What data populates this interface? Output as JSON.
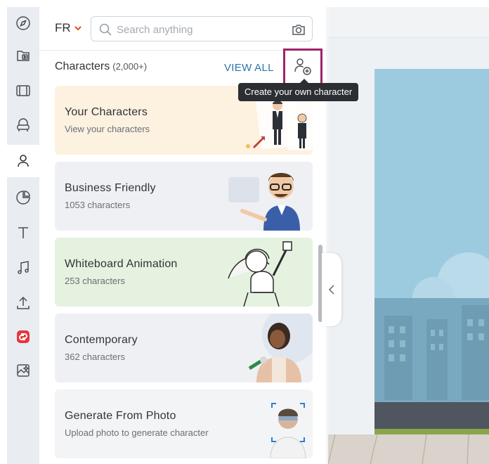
{
  "rail": {
    "items": [
      {
        "icon": "compass-icon"
      },
      {
        "icon": "media-library-icon"
      },
      {
        "icon": "scenes-icon"
      },
      {
        "icon": "props-icon"
      },
      {
        "icon": "characters-icon",
        "active": true
      },
      {
        "icon": "charts-icon"
      },
      {
        "icon": "text-icon"
      },
      {
        "icon": "music-icon"
      },
      {
        "icon": "upload-icon"
      },
      {
        "icon": "brand-app-icon",
        "color": "#e8343b"
      },
      {
        "icon": "ai-image-icon"
      }
    ]
  },
  "topbar": {
    "language": "FR",
    "search_placeholder": "Search anything"
  },
  "section": {
    "title": "Characters",
    "count": "(2,000+)",
    "view_all": "VIEW ALL"
  },
  "tooltip": {
    "text": "Create your own character"
  },
  "cards": [
    {
      "title": "Your Characters",
      "subtitle": "View your characters",
      "bg": "#fdf1e0"
    },
    {
      "title": "Business Friendly",
      "subtitle": "1053 characters",
      "bg": "#eef0f4"
    },
    {
      "title": "Whiteboard Animation",
      "subtitle": "253 characters",
      "bg": "#e4f2df"
    },
    {
      "title": "Contemporary",
      "subtitle": "362 characters",
      "bg": "#eef0f4"
    },
    {
      "title": "Generate From Photo",
      "subtitle": "Upload photo to generate character",
      "bg": "#f3f4f6"
    }
  ],
  "colors": {
    "accent": "#2a78a8",
    "highlight_border": "#a0236b",
    "tooltip_bg": "#2b2e33"
  }
}
